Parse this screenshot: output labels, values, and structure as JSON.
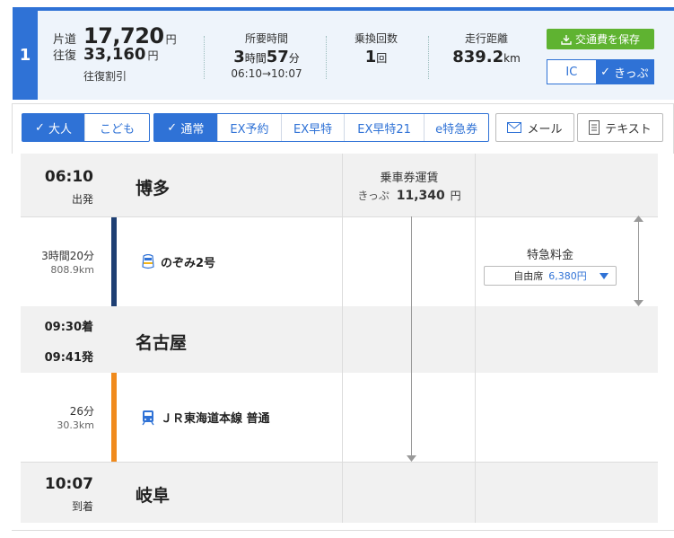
{
  "route": {
    "number": "1",
    "fare_oneway_label": "片道",
    "fare_oneway": "17,720",
    "fare_roundtrip_label": "往復",
    "fare_roundtrip": "33,160",
    "yen": "円",
    "roundtrip_discount": "往復割引",
    "duration_label": "所要時間",
    "duration_h": "3",
    "duration_h_unit": "時間",
    "duration_m": "57",
    "duration_m_unit": "分",
    "time_range": "06:10→10:07",
    "transfers_label": "乗換回数",
    "transfers": "1",
    "transfers_unit": "回",
    "distance_label": "走行距離",
    "distance": "839.2",
    "distance_unit": "km",
    "save_button": "交通費を保存",
    "toggle_ic": "IC",
    "toggle_kippu": "きっぷ"
  },
  "options": {
    "passenger": [
      "大人",
      "こども"
    ],
    "ticket_types": [
      "通常",
      "EX予約",
      "EX早特",
      "EX早特21",
      "e特急券"
    ],
    "mail": "メール",
    "text": "テキスト"
  },
  "timeline": {
    "dep_time": "06:10",
    "dep_label": "出発",
    "dep_station": "博多",
    "fare_title": "乗車券運賃",
    "fare_kind": "きっぷ",
    "fare_value": "11,340",
    "fare_unit": "円",
    "seg1_duration": "3時間20分",
    "seg1_distance": "808.9km",
    "seg1_train": "のぞみ2号",
    "express_title": "特急料金",
    "express_seat": "自由席",
    "express_price": "6,380円",
    "mid_arr_time": "09:30着",
    "mid_dep_time": "09:41発",
    "mid_station": "名古屋",
    "seg2_duration": "26分",
    "seg2_distance": "30.3km",
    "seg2_train": "ＪＲ東海道本線 普通",
    "arr_time": "10:07",
    "arr_label": "到着",
    "arr_station": "岐阜"
  },
  "colors": {
    "accent": "#2f72d6",
    "shinkansen_line": "#1e3f73",
    "tokaido_line": "#f08a1c",
    "save_green": "#5fb331"
  }
}
